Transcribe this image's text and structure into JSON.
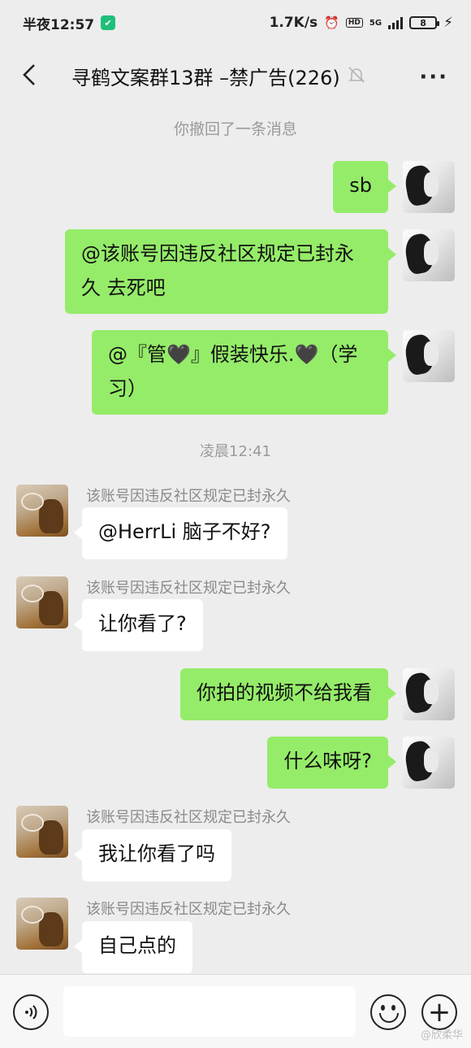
{
  "status": {
    "time": "半夜12:57",
    "net_speed": "1.7K/s",
    "network": "5G",
    "hd": "HD",
    "battery": "8"
  },
  "header": {
    "title": "寻鹤文案群13群 –禁广告(226)"
  },
  "messages": {
    "recalled": "你撤回了一条消息",
    "m1": "sb",
    "m2": "@该账号因违反社区规定已封永久  去死吧",
    "m3": "@『管🖤』假装快乐.🖤（学习）",
    "time1": "凌晨12:41",
    "sender": "该账号因违反社区规定已封永久",
    "o1": "@HerrLi  脑子不好?",
    "o2": "让你看了?",
    "m4": "你拍的视频不给我看",
    "m5": "什么味呀?",
    "o3": "我让你看了吗",
    "o4": "自己点的"
  },
  "watermark": "@欣柔华"
}
